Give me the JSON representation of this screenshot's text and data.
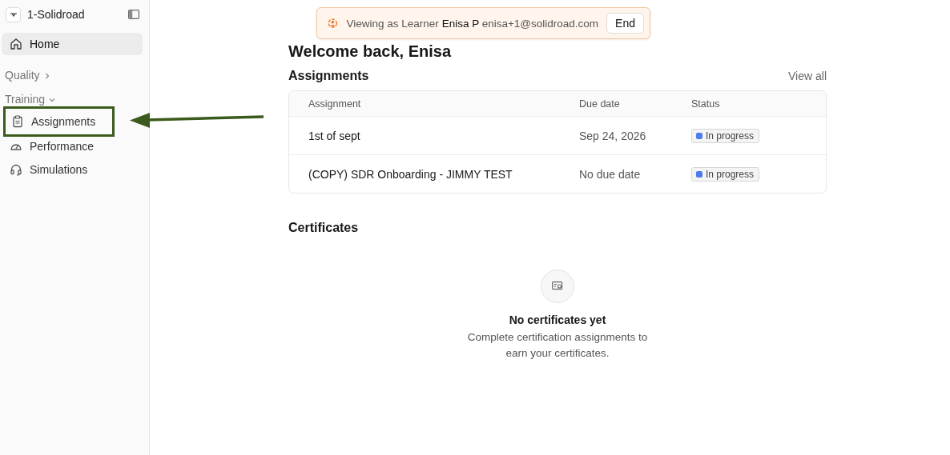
{
  "sidebar": {
    "workspace": "1-Solidroad",
    "top_items": [
      {
        "label": "Home",
        "selected": true
      }
    ],
    "sections": [
      {
        "label": "Quality",
        "expanded": false
      },
      {
        "label": "Training",
        "expanded": true,
        "items": [
          {
            "label": "Assignments",
            "selected": false,
            "annotated": true
          },
          {
            "label": "Performance",
            "selected": false,
            "annotated": false
          },
          {
            "label": "Simulations",
            "selected": false,
            "annotated": false
          }
        ]
      }
    ]
  },
  "banner": {
    "prefix": "Viewing as",
    "role": "Learner",
    "user": "Enisa P",
    "email": "enisa+1@solidroad.com",
    "button": "End"
  },
  "heading": "Welcome back, Enisa",
  "assignments": {
    "title": "Assignments",
    "link": "View all",
    "columns": [
      "Assignment",
      "Due date",
      "Status"
    ],
    "rows": [
      {
        "name": "1st of sept",
        "due": "Sep 24, 2026",
        "status": "In progress",
        "color": "#4c7cf0"
      },
      {
        "name": "(COPY) SDR Onboarding - JIMMY TEST",
        "due": "No due date",
        "status": "In progress",
        "color": "#4c7cf0"
      }
    ]
  },
  "certificates": {
    "title": "Certificates",
    "empty_title": "No certificates yet",
    "empty_text": "Complete certification assignments to earn your certificates."
  }
}
